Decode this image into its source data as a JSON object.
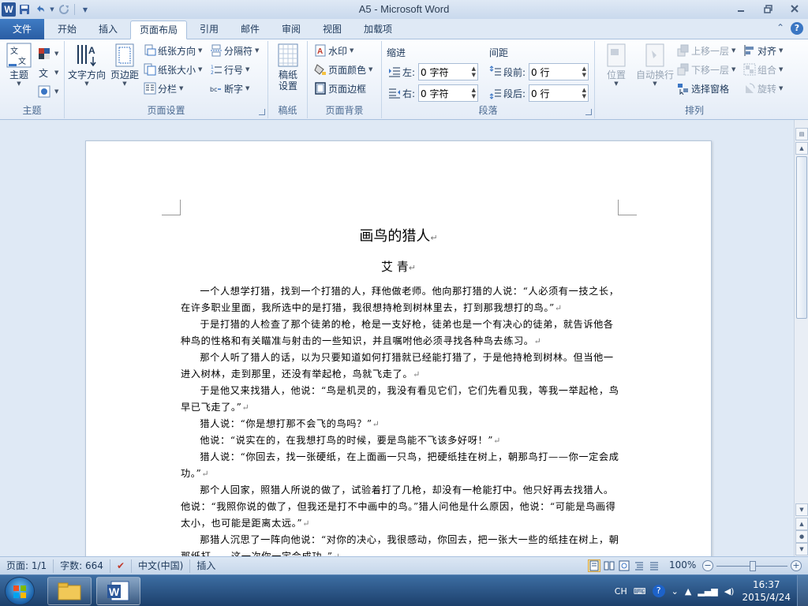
{
  "window": {
    "title": "A5 - Microsoft Word",
    "controls": [
      "minimize",
      "restore",
      "close"
    ]
  },
  "quick_access": {
    "app_icon": "W",
    "icons": [
      "word-icon",
      "save-icon",
      "undo-icon",
      "redo-icon",
      "customize-qat-icon"
    ]
  },
  "tabs": [
    {
      "label": "文件",
      "active": false,
      "file": true
    },
    {
      "label": "开始",
      "active": false
    },
    {
      "label": "插入",
      "active": false
    },
    {
      "label": "页面布局",
      "active": true
    },
    {
      "label": "引用",
      "active": false
    },
    {
      "label": "邮件",
      "active": false
    },
    {
      "label": "审阅",
      "active": false
    },
    {
      "label": "视图",
      "active": false
    },
    {
      "label": "加载项",
      "active": false
    }
  ],
  "ribbon": {
    "theme_group": {
      "label": "主题",
      "themes_button": "主题"
    },
    "page_setup": {
      "label": "页面设置",
      "text_direction": "文字方向",
      "margins": "页边距",
      "orientation": "纸张方向",
      "size": "纸张大小",
      "columns": "分栏",
      "breaks": "分隔符",
      "line_numbers": "行号",
      "hyphenation": "断字"
    },
    "draft_paper": {
      "label": "稿纸",
      "button": "稿纸\n设置",
      "line1": "稿纸",
      "line2": "设置"
    },
    "page_background": {
      "label": "页面背景",
      "watermark": "水印",
      "page_color": "页面颜色",
      "page_borders": "页面边框"
    },
    "paragraph": {
      "label": "段落",
      "indent_title": "缩进",
      "spacing_title": "间距",
      "left_label": "左:",
      "left_value": "0 字符",
      "right_label": "右:",
      "right_value": "0 字符",
      "before_label": "段前:",
      "before_value": "0 行",
      "after_label": "段后:",
      "after_value": "0 行"
    },
    "arrange": {
      "label": "排列",
      "position": "位置",
      "wrap_text": "自动换行",
      "bring_forward": "上移一层",
      "send_backward": "下移一层",
      "selection_pane": "选择窗格",
      "align": "对齐",
      "group": "组合",
      "rotate": "旋转"
    }
  },
  "document": {
    "title": "画鸟的猎人",
    "author": "艾  青",
    "paragraphs": [
      "一个人想学打猎，找到一个打猎的人，拜他做老师。他向那打猎的人说：“人必须有一技之长，在许多职业里面，我所选中的是打猎，我很想持枪到树林里去，打到那我想打的鸟。”",
      "于是打猎的人检查了那个徒弟的枪，枪是一支好枪，徒弟也是一个有决心的徒弟，就告诉他各种鸟的性格和有关瞄准与射击的一些知识，并且嘱咐他必须寻找各种鸟去练习。",
      "那个人听了猎人的话，以为只要知道如何打猎就已经能打猎了，于是他持枪到树林。但当他一进入树林，走到那里，还没有举起枪，鸟就飞走了。",
      "于是他又来找猎人，他说：“鸟是机灵的，我没有看见它们，它们先看见我，等我一举起枪，鸟早已飞走了。”",
      "猎人说：“你是想打那不会飞的鸟吗？”",
      "他说：“说实在的，在我想打鸟的时候，要是鸟能不飞该多好呀！”",
      "猎人说：“你回去，找一张硬纸，在上面画一只鸟，把硬纸挂在树上，朝那鸟打——你一定会成功。”",
      "那个人回家，照猎人所说的做了，试验着打了几枪，却没有一枪能打中。他只好再去找猎人。他说：“我照你说的做了，但我还是打不中画中的鸟。”猎人问他是什么原因，他说：“可能是鸟画得太小，也可能是距离太远。”",
      "那猎人沉思了一阵向他说：“对你的决心，我很感动，你回去，把一张大一些的纸挂在树上，朝那纸打——这一次你一定会成功。”"
    ]
  },
  "status": {
    "page": "页面: 1/1",
    "words": "字数: 664",
    "language": "中文(中国)",
    "mode": "插入",
    "zoom": "100%",
    "zoom_percent": 100
  },
  "taskbar": {
    "tray_lang": "CH",
    "time": "16:37",
    "date": "2015/4/24"
  },
  "colors": {
    "file_tab": "#2a5da3",
    "ribbon_bg": "#e4ecf7",
    "taskbar": "#1c3f6b"
  }
}
